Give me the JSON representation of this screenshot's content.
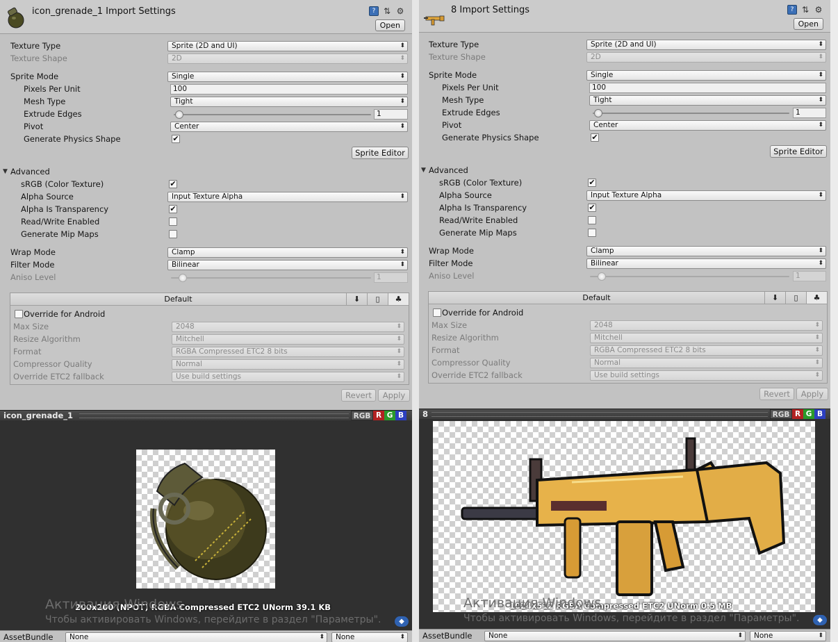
{
  "left": {
    "title": "icon_grenade_1 Import Settings",
    "open_label": "Open",
    "texture_type": {
      "label": "Texture Type",
      "value": "Sprite (2D and UI)"
    },
    "texture_shape": {
      "label": "Texture Shape",
      "value": "2D"
    },
    "sprite_mode": {
      "label": "Sprite Mode",
      "value": "Single"
    },
    "pixels_per_unit": {
      "label": "Pixels Per Unit",
      "value": "100"
    },
    "mesh_type": {
      "label": "Mesh Type",
      "value": "Tight"
    },
    "extrude_edges": {
      "label": "Extrude Edges",
      "value": "1",
      "fraction": 0.03
    },
    "pivot": {
      "label": "Pivot",
      "value": "Center"
    },
    "generate_physics_shape": {
      "label": "Generate Physics Shape",
      "checked": true
    },
    "sprite_editor_label": "Sprite Editor",
    "advanced_label": "Advanced",
    "srgb": {
      "label": "sRGB (Color Texture)",
      "checked": true
    },
    "alpha_source": {
      "label": "Alpha Source",
      "value": "Input Texture Alpha"
    },
    "alpha_is_transparency": {
      "label": "Alpha Is Transparency",
      "checked": true
    },
    "read_write": {
      "label": "Read/Write Enabled",
      "checked": false
    },
    "mip_maps": {
      "label": "Generate Mip Maps",
      "checked": false
    },
    "wrap_mode": {
      "label": "Wrap Mode",
      "value": "Clamp"
    },
    "filter_mode": {
      "label": "Filter Mode",
      "value": "Bilinear"
    },
    "aniso_level": {
      "label": "Aniso Level",
      "value": "1",
      "fraction": 0.06
    },
    "platform": {
      "tab_label": "Default",
      "override_label": "Override for Android",
      "override_checked": false,
      "max_size": {
        "label": "Max Size",
        "value": "2048"
      },
      "resize_algorithm": {
        "label": "Resize Algorithm",
        "value": "Mitchell"
      },
      "format": {
        "label": "Format",
        "value": "RGBA Compressed ETC2 8 bits"
      },
      "compressor_quality": {
        "label": "Compressor Quality",
        "value": "Normal"
      },
      "etc2_fallback": {
        "label": "Override ETC2 fallback",
        "value": "Use build settings"
      }
    },
    "revert_label": "Revert",
    "apply_label": "Apply",
    "preview": {
      "name": "icon_grenade_1",
      "channels": {
        "rgb": "RGB",
        "r": "R",
        "g": "G",
        "b": "B"
      },
      "info": "200x200 (NPOT)  RGBA Compressed ETC2 UNorm   39.1 KB"
    },
    "watermark": {
      "line1": "Активация Windows",
      "line2": "Чтобы активировать Windows, перейдите в раздел \"Параметры\"."
    },
    "assetbundle": {
      "label": "AssetBundle",
      "value": "None",
      "variant": "None"
    }
  },
  "right": {
    "title": "8 Import Settings",
    "open_label": "Open",
    "texture_type": {
      "label": "Texture Type",
      "value": "Sprite (2D and UI)"
    },
    "texture_shape": {
      "label": "Texture Shape",
      "value": "2D"
    },
    "sprite_mode": {
      "label": "Sprite Mode",
      "value": "Single"
    },
    "pixels_per_unit": {
      "label": "Pixels Per Unit",
      "value": "100"
    },
    "mesh_type": {
      "label": "Mesh Type",
      "value": "Tight"
    },
    "extrude_edges": {
      "label": "Extrude Edges",
      "value": "1",
      "fraction": 0.03
    },
    "pivot": {
      "label": "Pivot",
      "value": "Center"
    },
    "generate_physics_shape": {
      "label": "Generate Physics Shape",
      "checked": true
    },
    "sprite_editor_label": "Sprite Editor",
    "advanced_label": "Advanced",
    "srgb": {
      "label": "sRGB (Color Texture)",
      "checked": true
    },
    "alpha_source": {
      "label": "Alpha Source",
      "value": "Input Texture Alpha"
    },
    "alpha_is_transparency": {
      "label": "Alpha Is Transparency",
      "checked": true
    },
    "read_write": {
      "label": "Read/Write Enabled",
      "checked": false
    },
    "mip_maps": {
      "label": "Generate Mip Maps",
      "checked": false
    },
    "wrap_mode": {
      "label": "Wrap Mode",
      "value": "Clamp"
    },
    "filter_mode": {
      "label": "Filter Mode",
      "value": "Bilinear"
    },
    "aniso_level": {
      "label": "Aniso Level",
      "value": "1",
      "fraction": 0.06
    },
    "platform": {
      "tab_label": "Default",
      "override_label": "Override for Android",
      "override_checked": false,
      "max_size": {
        "label": "Max Size",
        "value": "2048"
      },
      "resize_algorithm": {
        "label": "Resize Algorithm",
        "value": "Mitchell"
      },
      "format": {
        "label": "Format",
        "value": "RGBA Compressed ETC2 8 bits"
      },
      "compressor_quality": {
        "label": "Compressor Quality",
        "value": "Normal"
      },
      "etc2_fallback": {
        "label": "Override ETC2 fallback",
        "value": "Use build settings"
      }
    },
    "revert_label": "Revert",
    "apply_label": "Apply",
    "preview": {
      "name": "8",
      "channels": {
        "rgb": "RGB",
        "r": "R",
        "g": "G",
        "b": "B"
      },
      "info": "1024x512  RGBA Compressed ETC2 UNorm   0.5 MB"
    },
    "watermark": {
      "line1": "Активация Windows",
      "line2": "Чтобы активировать Windows, перейдите в раздел \"Параметры\"."
    },
    "assetbundle": {
      "label": "AssetBundle",
      "value": "None",
      "variant": "None"
    }
  },
  "icons": {
    "help": "help-book-icon",
    "presets": "presets-sliders-icon",
    "settings": "gear-icon",
    "download": "download-icon",
    "mobile": "mobile-icon",
    "android": "android-icon",
    "tag": "asset-label-icon"
  },
  "colors": {
    "panel": "#c2c2c2",
    "preview_bg": "#303030",
    "check_accent": "#1e3f8a",
    "tag": "#2f62b2"
  }
}
